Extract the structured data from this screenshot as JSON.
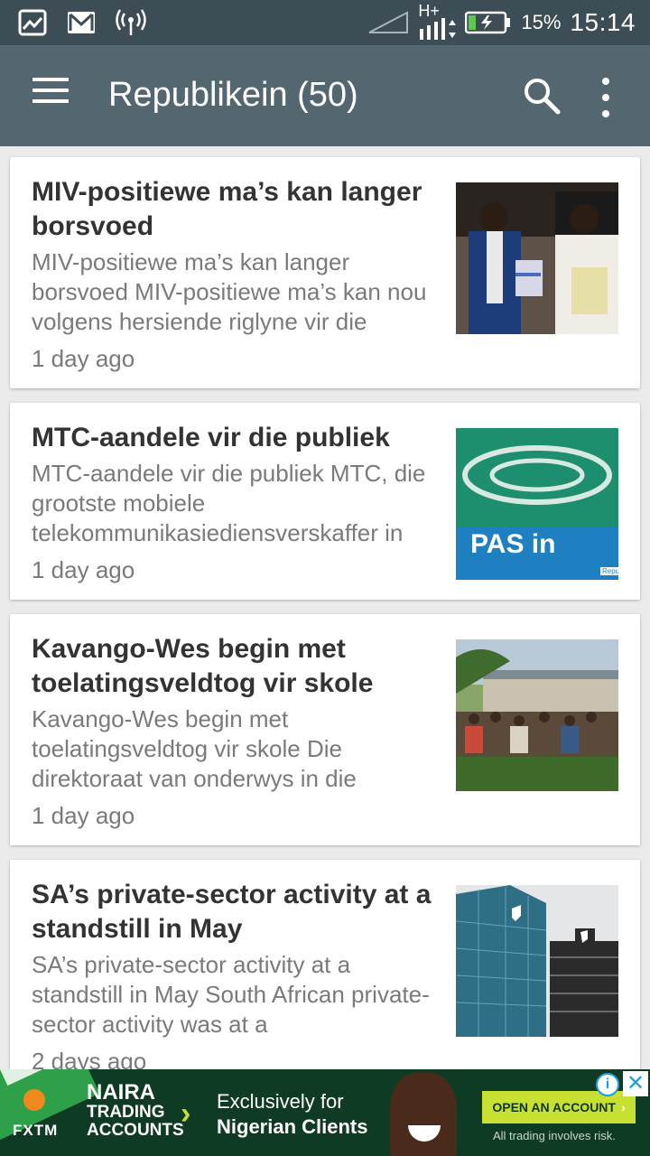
{
  "status_bar": {
    "time": "15:14",
    "battery_percent": "15%",
    "network_label": "H+",
    "icons": [
      "image-icon",
      "gmail-icon",
      "radio-tower-icon",
      "signal-icon",
      "battery-charging-icon"
    ]
  },
  "toolbar": {
    "title": "Republikein (50)",
    "icons": [
      "menu-icon",
      "search-icon",
      "more-vert-icon"
    ]
  },
  "articles": [
    {
      "title": "MIV-positiewe ma’s kan langer borsvoed",
      "snippet": "MIV-positiewe ma’s kan langer borsvoed MIV-positiewe ma’s kan nou volgens hersiende riglyne vir die",
      "time": "1 day ago"
    },
    {
      "title": "MTC-aandele vir die publiek",
      "snippet": "MTC-aandele vir die publiek MTC, die grootste mobiele telekommunikasiediensverskaffer in",
      "time": "1 day ago",
      "image_text": "PAS in",
      "image_small_text": "Repu"
    },
    {
      "title": "Kavango-Wes begin met toelatingsveldtog vir skole",
      "snippet": "Kavango-Wes begin met toelatingsveldtog vir skole Die direktoraat van onderwys in die",
      "time": "1 day ago"
    },
    {
      "title": "SA’s private-sector activity at a standstill in May",
      "snippet": "SA’s private-sector activity at a standstill in May South African private-sector activity was at a",
      "time": "2 days ago"
    }
  ],
  "ad": {
    "brand": "FXTM",
    "line1": "NAIRA",
    "line2": "TRADING",
    "line3": "ACCOUNTS",
    "tagline1": "Exclusively for",
    "tagline2": "Nigerian Clients",
    "cta": "OPEN AN ACCOUNT",
    "disclaimer": "All trading involves risk.",
    "colors": {
      "background": "#0f3a24",
      "accent": "#c8e031"
    }
  },
  "colors": {
    "status_bar": "#3d4d55",
    "toolbar": "#546770",
    "list_background": "#ebebeb"
  }
}
